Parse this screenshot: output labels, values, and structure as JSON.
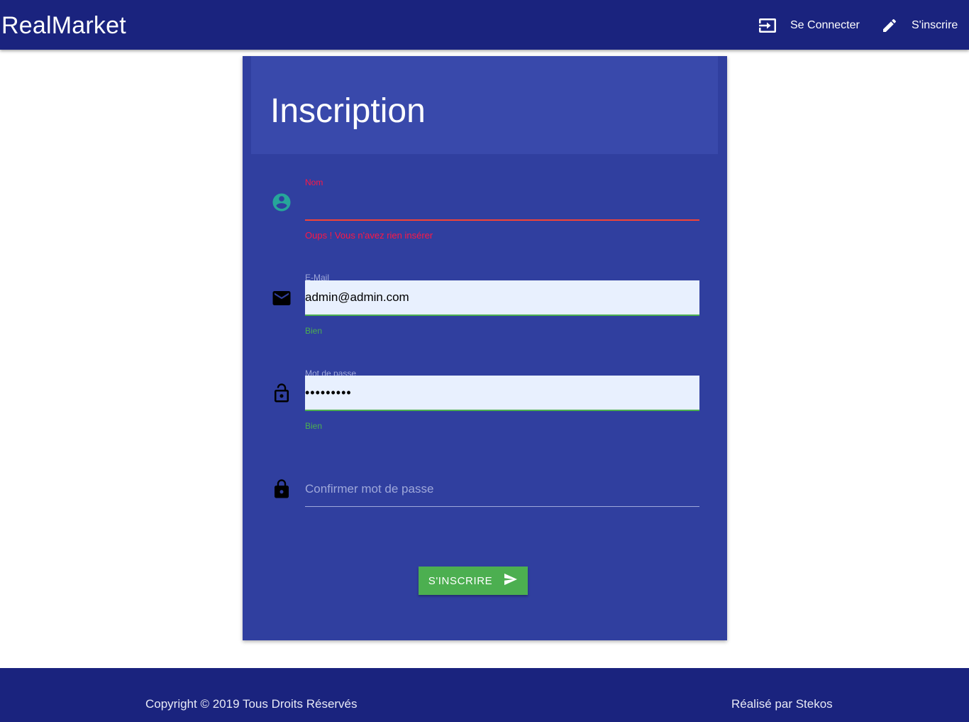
{
  "navbar": {
    "brand": "RealMarket",
    "login": {
      "label": "Se Connecter",
      "icon": "login-icon"
    },
    "signup": {
      "label": "S'inscrire",
      "icon": "pencil-icon"
    }
  },
  "form": {
    "title": "Inscription",
    "nom": {
      "label": "Nom",
      "value": "",
      "helper": "Oups ! Vous n'avez rien insérer",
      "icon": "account-circle-icon",
      "icon_color": "#26a69a"
    },
    "email": {
      "label": "E-Mail",
      "value": "admin@admin.com",
      "helper": "Bien",
      "icon": "mail-icon"
    },
    "password": {
      "label": "Mot de passe",
      "value": "•••••••••",
      "helper": "Bien",
      "icon": "lock-open-icon"
    },
    "confirm": {
      "placeholder": "Confirmer mot de passe",
      "value": "",
      "icon": "lock-icon"
    },
    "submit": {
      "label": "S'INSCRIRE",
      "icon": "send-icon"
    }
  },
  "footer": {
    "copyright": "Copyright © 2019 Tous Droits Réservés",
    "credit": "Réalisé par Stekos"
  },
  "colors": {
    "navbar": "#1a237e",
    "card": "#303f9f",
    "card_header": "#3949ab",
    "error": "#ff1744",
    "success": "#4caf50"
  }
}
